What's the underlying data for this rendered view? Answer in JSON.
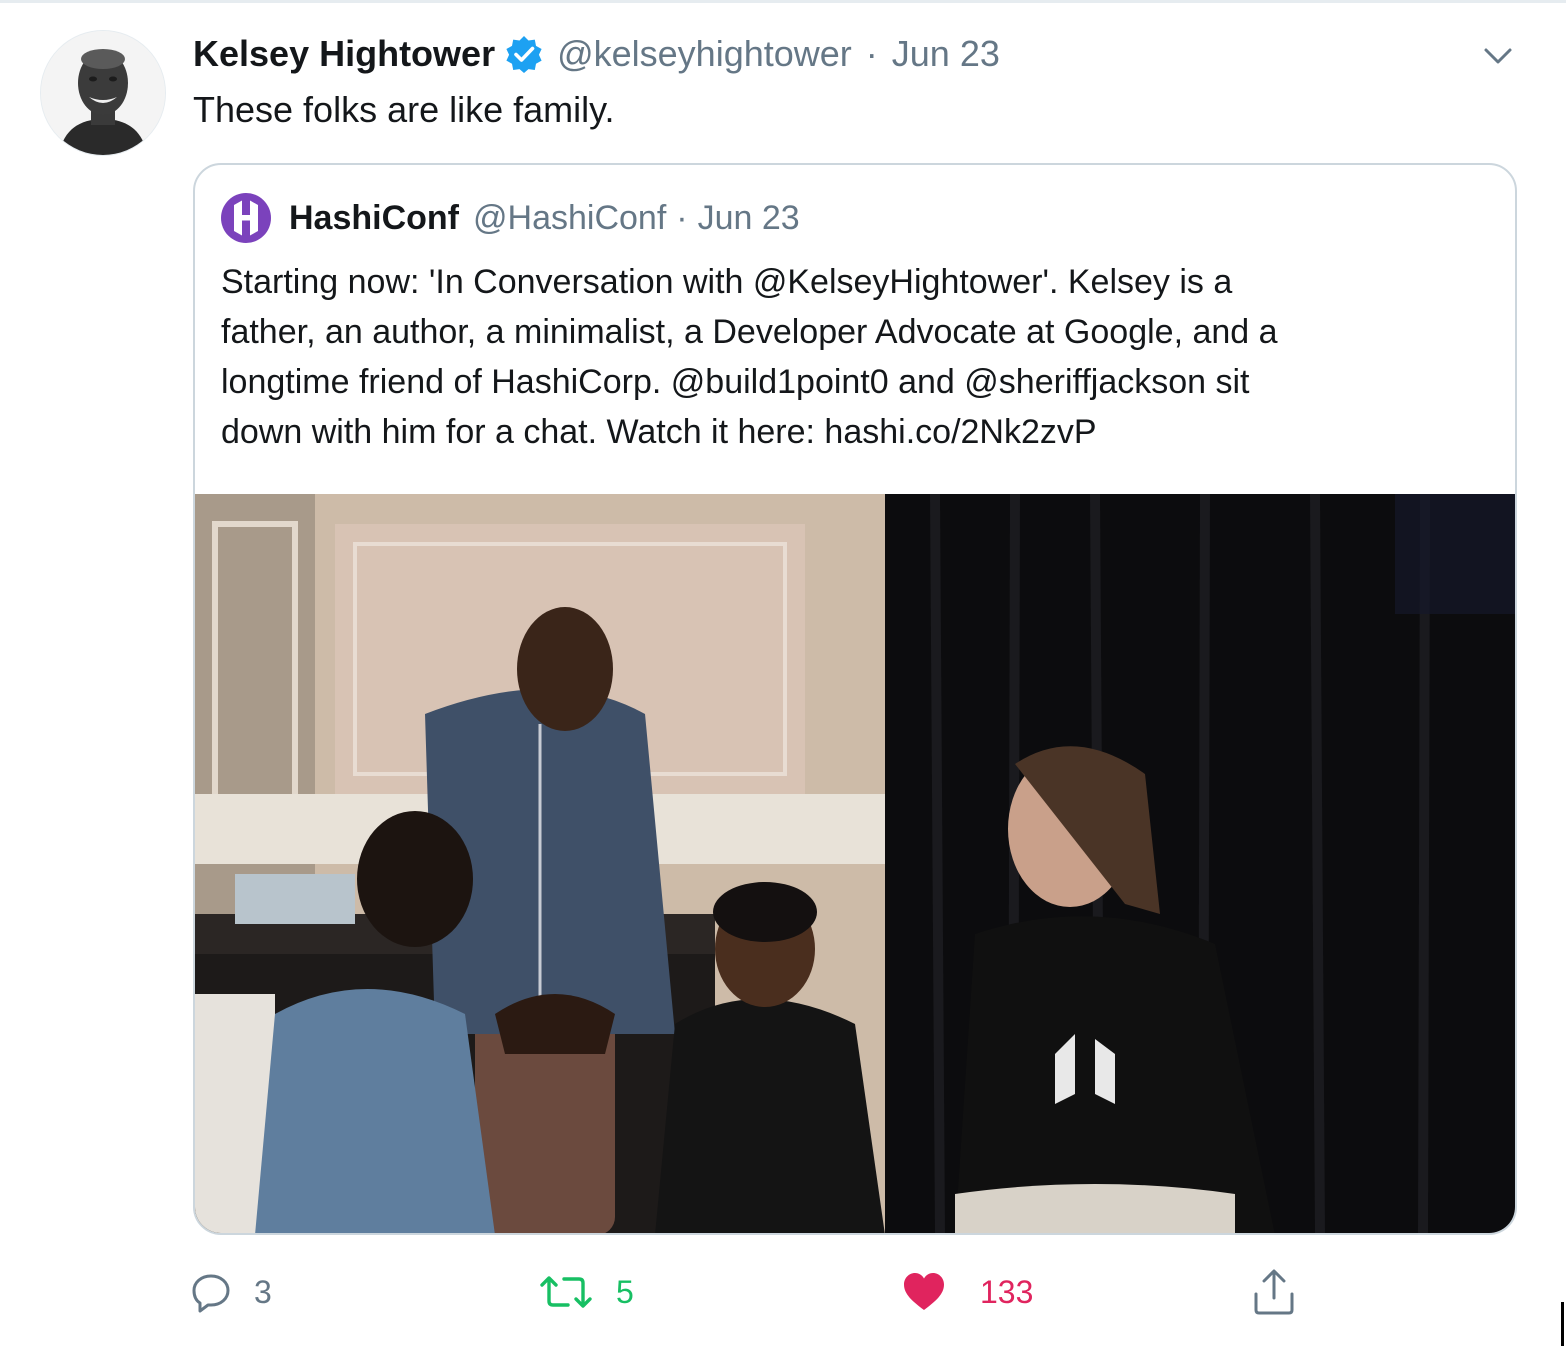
{
  "author": {
    "name": "Kelsey Hightower",
    "handle": "@kelseyhightower",
    "separator": "·",
    "date": "Jun 23",
    "avatar_icon": "profile-photo",
    "verified_icon": "verified-badge-icon"
  },
  "tweet": {
    "text": "These folks are like family."
  },
  "quoted_tweet": {
    "name": "HashiConf",
    "handle": "@HashiConf",
    "separator": "·",
    "date": "Jun 23",
    "logo_icon": "hashicorp-logo-icon",
    "text_lines": [
      "Starting now: 'In Conversation with @KelseyHightower'. Kelsey is a",
      "father, an author, a minimalist, a Developer Advocate at Google, and a",
      "longtime friend of HashiCorp. @build1point0 and @sheriffjackson sit",
      "down with him for a chat. Watch it here: hashi.co/2Nk2zvP"
    ]
  },
  "actions": {
    "reply_count": "3",
    "retweet_count": "5",
    "like_count": "133",
    "reply_icon": "reply-icon",
    "retweet_icon": "retweet-icon",
    "like_icon": "heart-icon",
    "share_icon": "share-icon"
  },
  "colors": {
    "muted_text": "#657786",
    "verified_blue": "#1da1f2",
    "retweet_green": "#17bf63",
    "like_red": "#e0245e",
    "border": "#ccd6dd"
  }
}
